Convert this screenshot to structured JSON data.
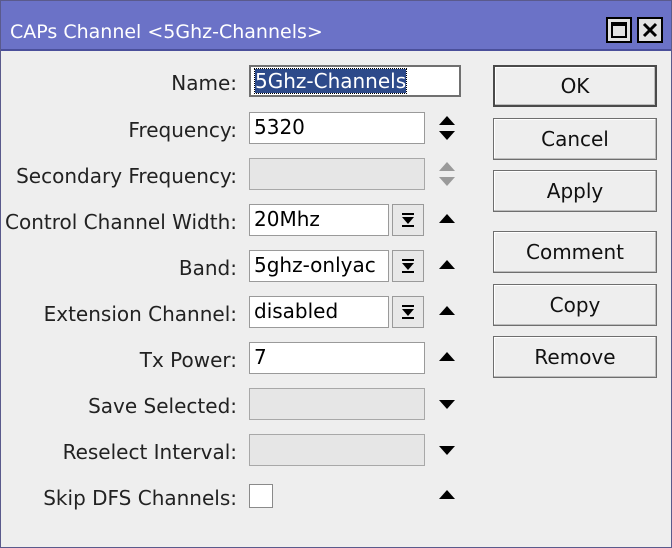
{
  "window": {
    "title": "CAPs Channel <5Ghz-Channels>",
    "controls": {
      "maximize": "maximize-icon",
      "close": "close-icon"
    }
  },
  "form": {
    "name": {
      "label": "Name:",
      "value": "5Ghz-Channels"
    },
    "frequency": {
      "label": "Frequency:",
      "value": "5320"
    },
    "secondary_frequency": {
      "label": "Secondary Frequency:",
      "value": ""
    },
    "control_channel_width": {
      "label": "Control Channel Width:",
      "value": "20Mhz"
    },
    "band": {
      "label": "Band:",
      "value": "5ghz-onlyac"
    },
    "extension_channel": {
      "label": "Extension Channel:",
      "value": "disabled"
    },
    "tx_power": {
      "label": "Tx Power:",
      "value": "7"
    },
    "save_selected": {
      "label": "Save Selected:",
      "value": ""
    },
    "reselect_interval": {
      "label": "Reselect Interval:",
      "value": ""
    },
    "skip_dfs_channels": {
      "label": "Skip DFS Channels:",
      "checked": false
    }
  },
  "buttons": {
    "ok": "OK",
    "cancel": "Cancel",
    "apply": "Apply",
    "comment": "Comment",
    "copy": "Copy",
    "remove": "Remove"
  },
  "colors": {
    "titlebar": "#6b72c7",
    "window_bg": "#eeeeee",
    "selection": "#2d4a8a"
  }
}
